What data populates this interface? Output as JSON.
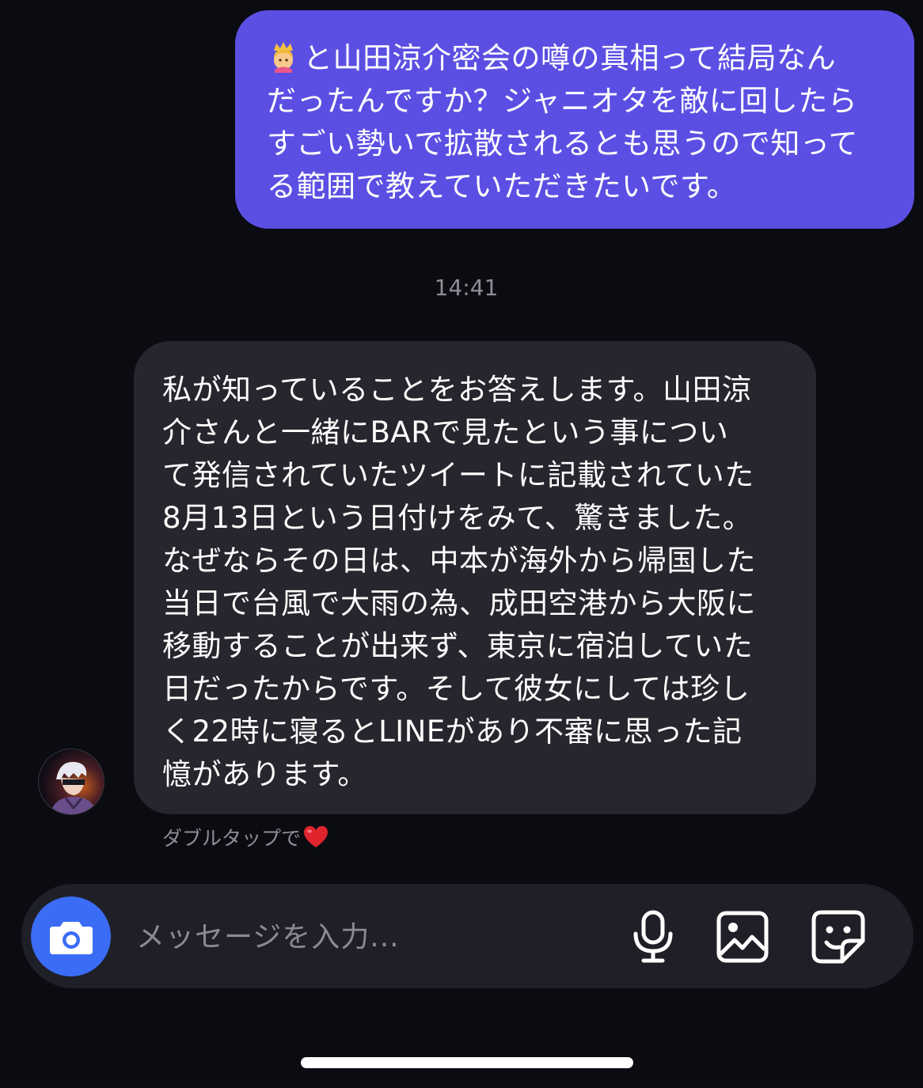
{
  "sent_message": {
    "emoji": "👸",
    "text": "と山田涼介密会の噂の真相って結局なん\nだったんですか？ジャニオタを敵に回したら\nすごい勢いで拡散されるとも思うので知って\nる範囲で教えていただきたいです。"
  },
  "timestamp": "14:41",
  "received_message": {
    "text": "私が知っていることをお答えします。山田涼\n介さんと一緒にBARで見たという事につい\nて発信されていたツイートに記載されていた\n8月13日という日付けをみて、驚きました。\nなぜならその日は、中本が海外から帰国した\n当日で台風で大雨の為、成田空港から大阪に\n移動することが出来ず、東京に宿泊していた\n日だったからです。そして彼女にしては珍し\nく22時に寝るとLINEがあり不審に思った記\n憶があります。"
  },
  "reaction_hint": {
    "text": "ダブルタップで",
    "icon": "heart-icon"
  },
  "composer": {
    "placeholder": "メッセージを入力...",
    "value": "",
    "camera_icon": "camera-icon",
    "mic_icon": "microphone-icon",
    "gallery_icon": "image-icon",
    "sticker_icon": "sticker-icon"
  },
  "colors": {
    "background": "#0b0b12",
    "sent_bubble": "#5b4fe3",
    "received_bubble": "#26262e",
    "camera_button": "#3a6cf5",
    "heart": "#e0242e"
  }
}
